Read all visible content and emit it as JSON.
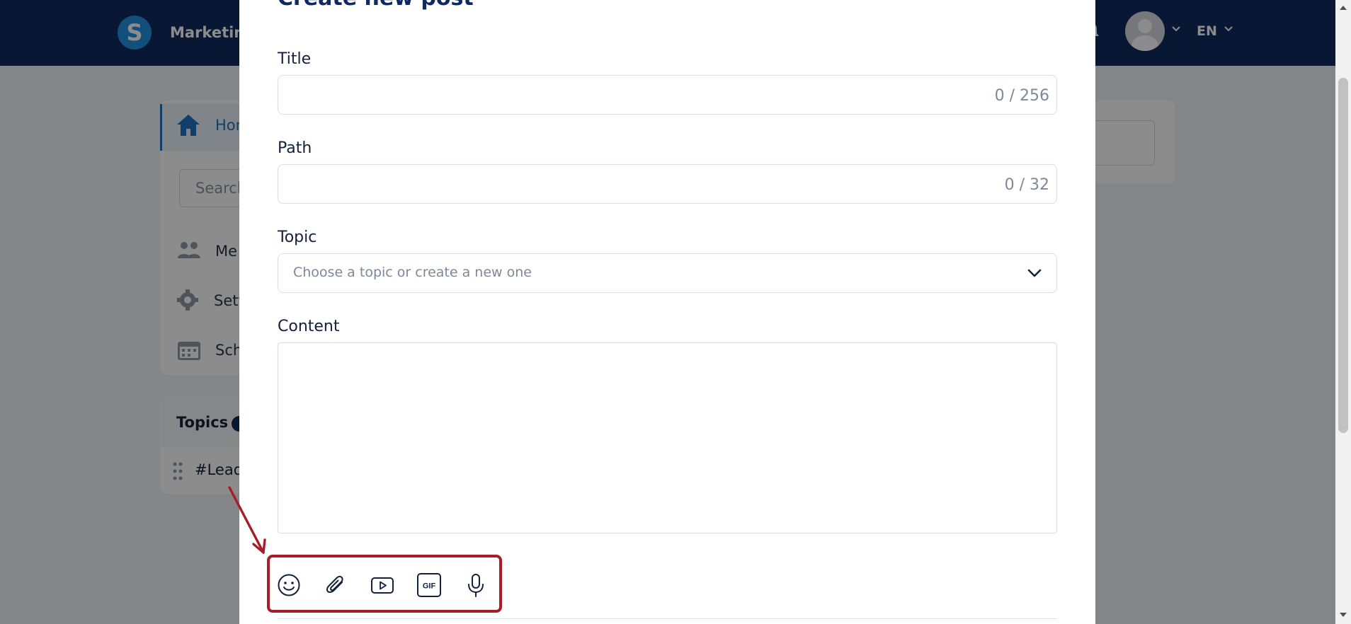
{
  "app": {
    "logo_letter": "S",
    "brand": "Marketing",
    "language": "EN"
  },
  "sidebar": {
    "home_label": "Hon",
    "search_placeholder": "Search",
    "items": [
      {
        "label": "Me",
        "icon": "users-icon"
      },
      {
        "label": "Sett",
        "icon": "gear-icon"
      },
      {
        "label": "Sch",
        "icon": "calendar-icon"
      }
    ],
    "topics_title": "Topics",
    "topic_item": "#Lead"
  },
  "modal": {
    "title": "Create new post",
    "fields": {
      "title_label": "Title",
      "title_counter": "0 / 256",
      "path_label": "Path",
      "path_counter": "0 / 32",
      "topic_label": "Topic",
      "topic_placeholder": "Choose a topic or create a new one",
      "content_label": "Content"
    },
    "toolbar": [
      {
        "name": "emoji-button",
        "icon": "smiley-icon"
      },
      {
        "name": "attach-button",
        "icon": "paperclip-icon"
      },
      {
        "name": "video-button",
        "icon": "video-play-icon"
      },
      {
        "name": "gif-button",
        "icon": "gif-icon",
        "text": "GIF"
      },
      {
        "name": "voice-button",
        "icon": "microphone-icon"
      }
    ]
  },
  "colors": {
    "header_bg": "#0f2a5f",
    "accent": "#1f74c4",
    "highlight": "#a61c28"
  }
}
